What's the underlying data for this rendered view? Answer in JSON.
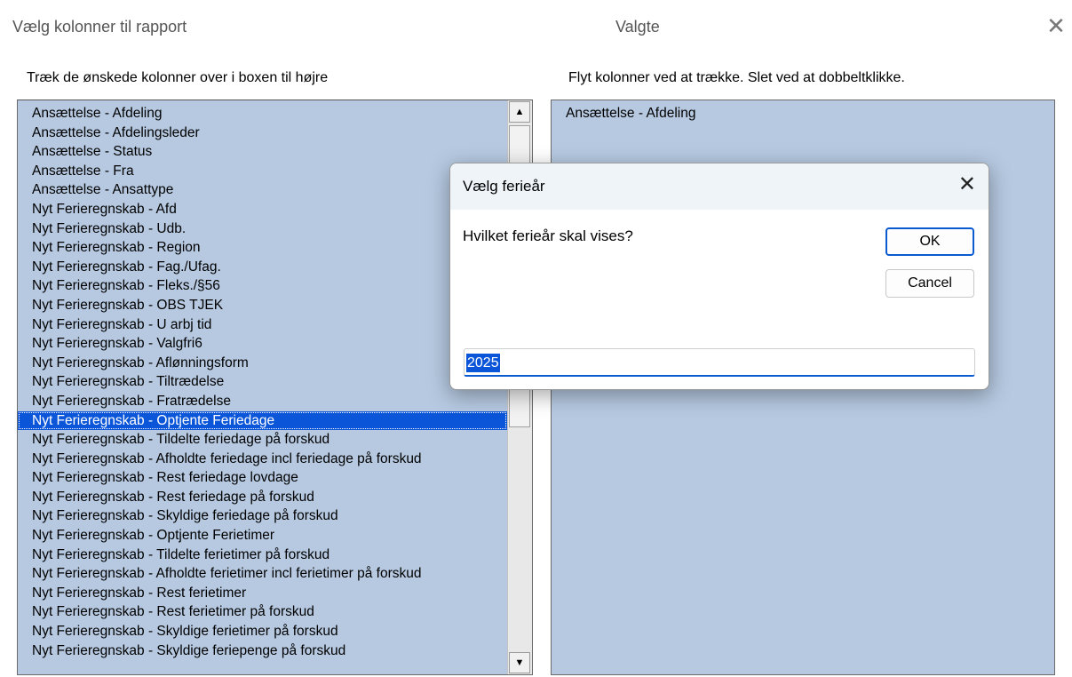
{
  "window": {
    "title_left": "Vælg kolonner til rapport",
    "title_right": "Valgte",
    "close_glyph": "✕"
  },
  "left_panel": {
    "instruction": "Træk de ønskede kolonner over i boxen til højre",
    "items": [
      "Ansættelse - Afdeling",
      "Ansættelse - Afdelingsleder",
      "Ansættelse - Status",
      "Ansættelse - Fra",
      "Ansættelse - Ansattype",
      "Nyt Ferieregnskab - Afd",
      "Nyt Ferieregnskab - Udb.",
      "Nyt Ferieregnskab - Region",
      "Nyt Ferieregnskab - Fag./Ufag.",
      "Nyt Ferieregnskab - Fleks./§56",
      "Nyt Ferieregnskab - OBS TJEK",
      "Nyt Ferieregnskab - U arbj tid",
      "Nyt Ferieregnskab - Valgfri6",
      "Nyt Ferieregnskab - Aflønningsform",
      "Nyt Ferieregnskab - Tiltrædelse",
      "Nyt Ferieregnskab - Fratrædelse",
      "Nyt Ferieregnskab - Optjente Feriedage",
      "Nyt Ferieregnskab - Tildelte feriedage på forskud",
      "Nyt Ferieregnskab - Afholdte feriedage incl feriedage på forskud",
      "Nyt Ferieregnskab - Rest feriedage lovdage",
      "Nyt Ferieregnskab - Rest feriedage på forskud",
      "Nyt Ferieregnskab - Skyldige feriedage på forskud",
      "Nyt Ferieregnskab - Optjente Ferietimer",
      "Nyt Ferieregnskab - Tildelte ferietimer på forskud",
      "Nyt Ferieregnskab - Afholdte ferietimer incl ferietimer på forskud",
      "Nyt Ferieregnskab - Rest ferietimer",
      "Nyt Ferieregnskab - Rest ferietimer på forskud",
      "Nyt Ferieregnskab - Skyldige ferietimer på forskud",
      "Nyt Ferieregnskab - Skyldige feriepenge på forskud"
    ],
    "selected_index": 16,
    "scroll_up_glyph": "▲",
    "scroll_down_glyph": "▼"
  },
  "right_panel": {
    "instruction": "Flyt kolonner ved at trække. Slet ved at dobbeltklikke.",
    "items": [
      "Ansættelse - Afdeling"
    ]
  },
  "dialog": {
    "title": "Vælg ferieår",
    "close_glyph": "✕",
    "question": "Hvilket ferieår skal vises?",
    "ok_label": "OK",
    "cancel_label": "Cancel",
    "input_value": "2025"
  }
}
